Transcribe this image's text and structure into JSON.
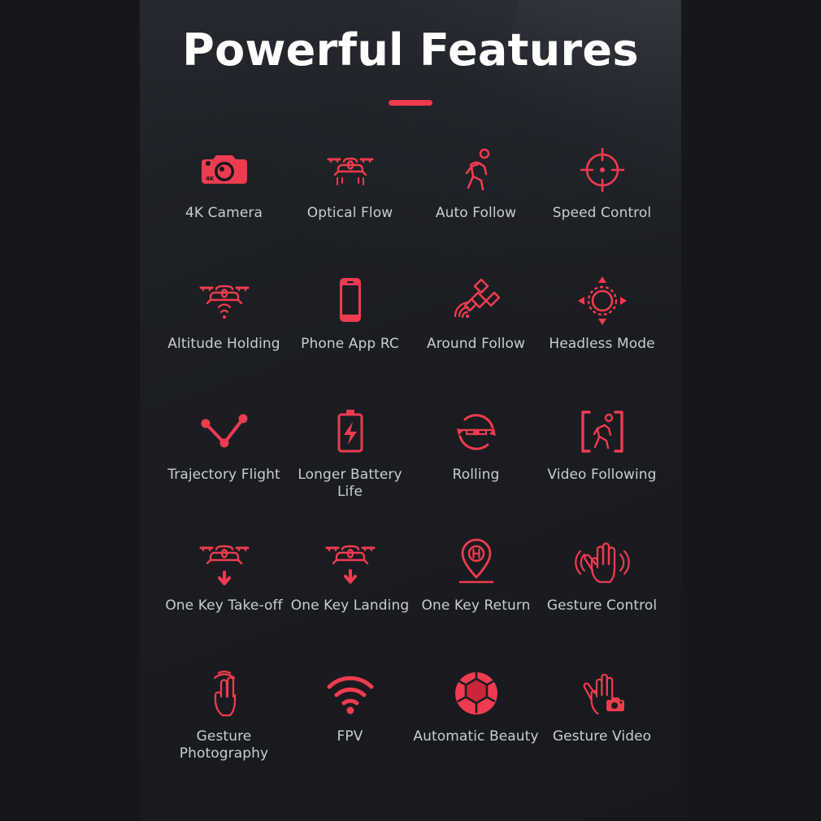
{
  "theme": {
    "background": "#15171b",
    "panel_background": "#1b1d22",
    "accent_red": "#f0394d",
    "icon_red": "#ef3b4f",
    "icon_red_dark": "#c3283c",
    "title_color": "#ffffff",
    "label_color": "#c9cdd2"
  },
  "header": {
    "title": "Powerful Features",
    "accent_bar": "accent-bar"
  },
  "features": [
    {
      "label": "4K Camera",
      "icon": "camera-4k-icon"
    },
    {
      "label": "Optical Flow",
      "icon": "drone-optical-flow-icon"
    },
    {
      "label": "Auto Follow",
      "icon": "running-person-icon"
    },
    {
      "label": "Speed Control",
      "icon": "crosshair-target-icon"
    },
    {
      "label": "Altitude Holding",
      "icon": "drone-sonar-icon"
    },
    {
      "label": "Phone App RC",
      "icon": "smartphone-icon"
    },
    {
      "label": "Around Follow",
      "icon": "satellite-signal-icon"
    },
    {
      "label": "Headless Mode",
      "icon": "compass-arrows-icon"
    },
    {
      "label": "Trajectory Flight",
      "icon": "waypoint-path-icon"
    },
    {
      "label": "Longer Battery Life",
      "icon": "battery-bolt-icon"
    },
    {
      "label": "Rolling",
      "icon": "drone-rotation-icon"
    },
    {
      "label": "Video Following",
      "icon": "person-in-frame-icon"
    },
    {
      "label": "One Key Take-off",
      "icon": "drone-up-arrow-icon"
    },
    {
      "label": "One Key Landing",
      "icon": "drone-down-arrow-icon"
    },
    {
      "label": "One Key Return",
      "icon": "home-pin-icon"
    },
    {
      "label": "Gesture Control",
      "icon": "waving-hand-icon"
    },
    {
      "label": "Gesture Photography",
      "icon": "peace-hand-waves-icon"
    },
    {
      "label": "FPV",
      "icon": "wifi-signal-icon"
    },
    {
      "label": "Automatic Beauty",
      "icon": "aperture-icon"
    },
    {
      "label": "Gesture Video",
      "icon": "hand-camera-icon"
    }
  ]
}
